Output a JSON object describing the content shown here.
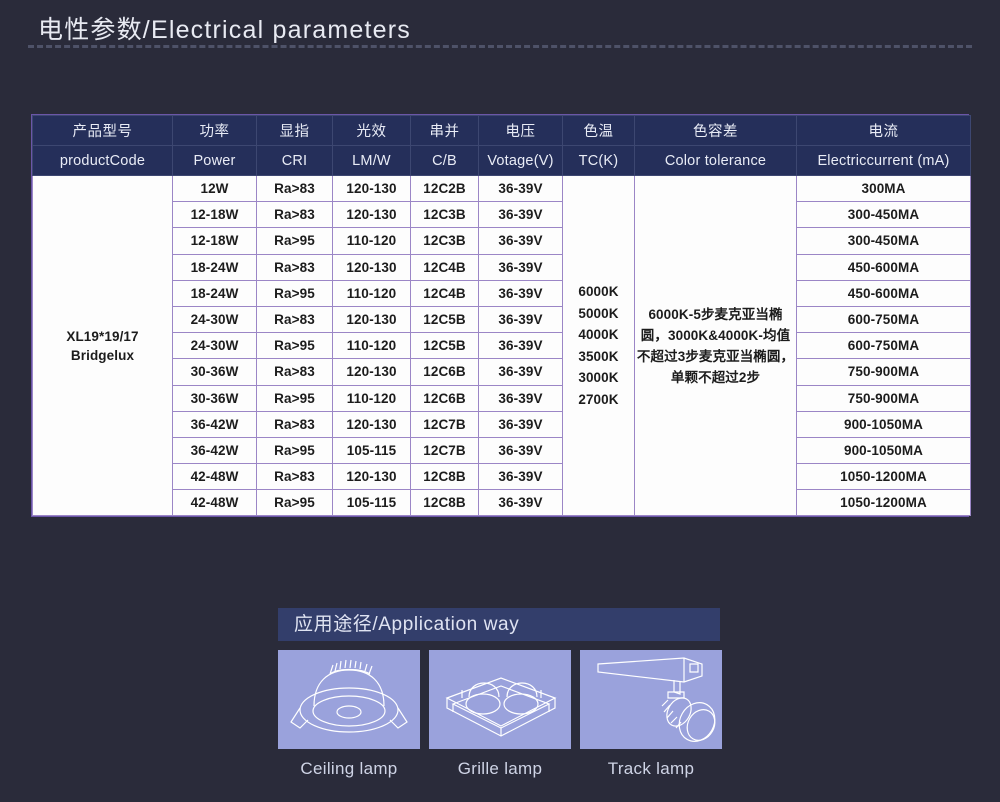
{
  "section": {
    "title": "电性参数/Electrical parameters"
  },
  "table": {
    "headers_cn": [
      "产品型号",
      "功率",
      "显指",
      "光效",
      "串并",
      "电压",
      "色温",
      "色容差",
      "电流"
    ],
    "headers_en": [
      "productCode",
      "Power",
      "CRI",
      "LM/W",
      "C/B",
      "Votage(V)",
      "TC(K)",
      "Color tolerance",
      "Electriccurrent (mA)"
    ],
    "product_code": "XL19*19/17\nBridgelux",
    "product_code_line1": "XL19*19/17",
    "product_code_line2": "Bridgelux",
    "color_temperatures": [
      "6000K",
      "5000K",
      "4000K",
      "3500K",
      "3000K",
      "2700K"
    ],
    "color_tolerance": "6000K-5步麦克亚当椭圆，3000K&4000K-均值不超过3步麦克亚当椭圆，单颗不超过2步",
    "rows": [
      {
        "power": "12W",
        "cri": "Ra>83",
        "lmw": "120-130",
        "cb": "12C2B",
        "voltage": "36-39V",
        "current": "300MA"
      },
      {
        "power": "12-18W",
        "cri": "Ra>83",
        "lmw": "120-130",
        "cb": "12C3B",
        "voltage": "36-39V",
        "current": "300-450MA"
      },
      {
        "power": "12-18W",
        "cri": "Ra>95",
        "lmw": "110-120",
        "cb": "12C3B",
        "voltage": "36-39V",
        "current": "300-450MA"
      },
      {
        "power": "18-24W",
        "cri": "Ra>83",
        "lmw": "120-130",
        "cb": "12C4B",
        "voltage": "36-39V",
        "current": "450-600MA"
      },
      {
        "power": "18-24W",
        "cri": "Ra>95",
        "lmw": "110-120",
        "cb": "12C4B",
        "voltage": "36-39V",
        "current": "450-600MA"
      },
      {
        "power": "24-30W",
        "cri": "Ra>83",
        "lmw": "120-130",
        "cb": "12C5B",
        "voltage": "36-39V",
        "current": "600-750MA"
      },
      {
        "power": "24-30W",
        "cri": "Ra>95",
        "lmw": "110-120",
        "cb": "12C5B",
        "voltage": "36-39V",
        "current": "600-750MA"
      },
      {
        "power": "30-36W",
        "cri": "Ra>83",
        "lmw": "120-130",
        "cb": "12C6B",
        "voltage": "36-39V",
        "current": "750-900MA"
      },
      {
        "power": "30-36W",
        "cri": "Ra>95",
        "lmw": "110-120",
        "cb": "12C6B",
        "voltage": "36-39V",
        "current": "750-900MA"
      },
      {
        "power": "36-42W",
        "cri": "Ra>83",
        "lmw": "120-130",
        "cb": "12C7B",
        "voltage": "36-39V",
        "current": "900-1050MA"
      },
      {
        "power": "36-42W",
        "cri": "Ra>95",
        "lmw": "105-115",
        "cb": "12C7B",
        "voltage": "36-39V",
        "current": "900-1050MA"
      },
      {
        "power": "42-48W",
        "cri": "Ra>83",
        "lmw": "120-130",
        "cb": "12C8B",
        "voltage": "36-39V",
        "current": "1050-1200MA"
      },
      {
        "power": "42-48W",
        "cri": "Ra>95",
        "lmw": "105-115",
        "cb": "12C8B",
        "voltage": "36-39V",
        "current": "1050-1200MA"
      }
    ]
  },
  "application": {
    "banner": "应用途径/Application way",
    "items": [
      {
        "label": "Ceiling lamp",
        "icon": "ceiling-lamp-icon"
      },
      {
        "label": "Grille lamp",
        "icon": "grille-lamp-icon"
      },
      {
        "label": "Track lamp",
        "icon": "track-lamp-icon"
      }
    ]
  },
  "colors": {
    "background": "#2a2b3a",
    "header_navy": "#252f5a",
    "banner_navy": "#333e6b",
    "cell_border": "#9b86c6",
    "thumb_bg": "#9aa2dc",
    "text_light": "#e8eaf2"
  }
}
